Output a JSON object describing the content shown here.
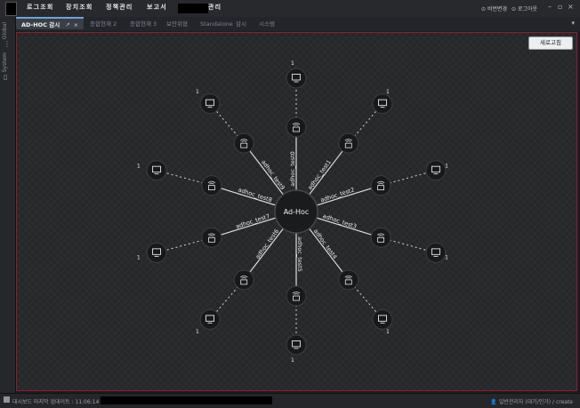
{
  "menubar": {
    "items": [
      "로그조회",
      "장치조회",
      "정책관리",
      "보고서",
      "관리"
    ],
    "password_change": "비번변경",
    "logout": "로그아웃"
  },
  "side": {
    "label_top": "Global",
    "label_bottom": "System"
  },
  "tabs": [
    {
      "label": "AD-HOC 감시",
      "active": true
    },
    {
      "label": "종합현재 2"
    },
    {
      "label": "종합현재 3"
    },
    {
      "label": "보안위협"
    },
    {
      "label": "Standalone"
    },
    {
      "label": "감시"
    },
    {
      "label": "시스템"
    }
  ],
  "refresh_button": "새로고침",
  "graph": {
    "center_label": "Ad-Hoc",
    "branches": [
      {
        "name": "adhoc_test0",
        "count": "1"
      },
      {
        "name": "adhoc_test1",
        "count": "1"
      },
      {
        "name": "adhoc_test2",
        "count": "1"
      },
      {
        "name": "adhoc_test3",
        "count": "1"
      },
      {
        "name": "adhoc_test4",
        "count": "1"
      },
      {
        "name": "adhoc_test5",
        "count": "1"
      },
      {
        "name": "adhoc_test6",
        "count": "1"
      },
      {
        "name": "adhoc_test7",
        "count": "1"
      },
      {
        "name": "adhoc_test8",
        "count": "1"
      },
      {
        "name": "adhoc_test9",
        "count": "1"
      }
    ]
  },
  "statusbar": {
    "left": "대시보드 마지막 업데이트 : 11:06:14",
    "right": "일반관리자 (대기/인가) / create"
  }
}
